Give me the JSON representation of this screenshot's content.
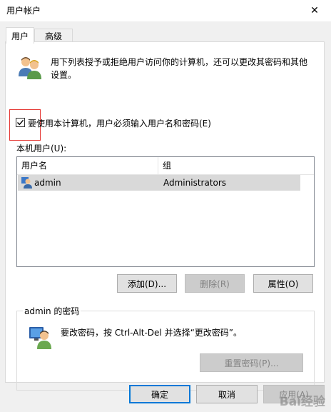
{
  "window": {
    "title": "用户帐户",
    "close_glyph": "✕"
  },
  "tabs": [
    {
      "label": "用户",
      "active": true
    },
    {
      "label": "高级",
      "active": false
    }
  ],
  "intro_text": "用下列表授予或拒绝用户访问你的计算机，还可以更改其密码和其他设置。",
  "require_login": {
    "label": "要使用本计算机，用户必须输入用户名和密码(E)",
    "checked": true
  },
  "local_users": {
    "label": "本机用户(U):",
    "columns": [
      "用户名",
      "组"
    ],
    "rows": [
      {
        "username": "admin",
        "group": "Administrators"
      }
    ]
  },
  "user_buttons": {
    "add": "添加(D)...",
    "remove": "删除(R)",
    "properties": "属性(O)"
  },
  "password_group": {
    "title": "admin 的密码",
    "text": "要改密码，按 Ctrl-Alt-Del 并选择“更改密码”。",
    "reset_button": "重置密码(P)..."
  },
  "dialog_buttons": {
    "ok": "确定",
    "cancel": "取消",
    "apply": "应用(A)"
  },
  "watermark": "Bai经验",
  "colors": {
    "highlight": "#e53935",
    "selected_row": "#d9d9d9",
    "default_button_border": "#0078d7"
  },
  "icons": {
    "users": "users-icon",
    "row_user": "user-icon",
    "password": "password-user-icon"
  }
}
